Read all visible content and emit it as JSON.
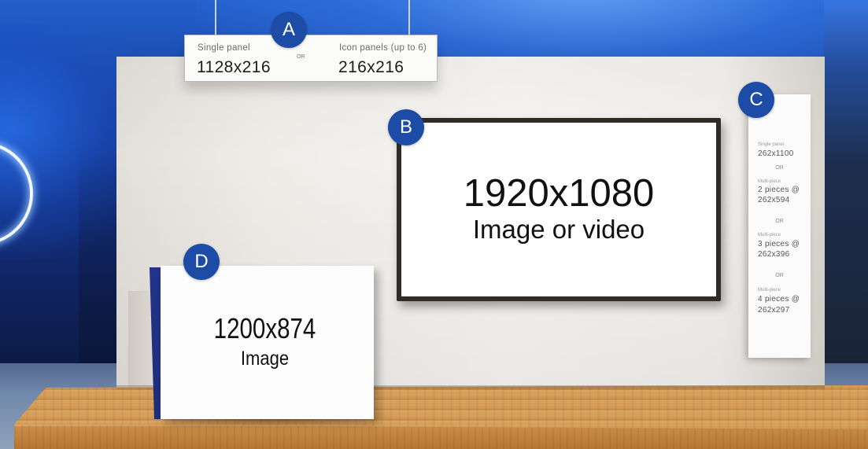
{
  "panels": {
    "a": {
      "badge": "A",
      "single_label": "Single panel",
      "single_size": "1128x216",
      "or_label": "OR",
      "icon_label": "Icon panels (up to 6)",
      "icon_size": "216x216"
    },
    "b": {
      "badge": "B",
      "size": "1920x1080",
      "caption": "Image or video"
    },
    "c": {
      "badge": "C",
      "or_label": "OR",
      "options": [
        {
          "label": "Single panel",
          "size": "262x1100"
        },
        {
          "label": "Multi-piece",
          "pieces": "2 pieces @",
          "size": "262x594"
        },
        {
          "label": "Multi-piece",
          "pieces": "3 pieces @",
          "size": "262x396"
        },
        {
          "label": "Multi-piece",
          "pieces": "4 pieces @",
          "size": "262x297"
        }
      ]
    },
    "d": {
      "badge": "D",
      "size": "1200x874",
      "caption": "Image"
    }
  },
  "colors": {
    "badge": "#1d4ca6",
    "badge_text": "#ffffff",
    "panel_text": "#111111",
    "screen_frame": "#2f2b27",
    "panel_d_side": "#1f2d7a",
    "stage_wood": "#d39a55"
  }
}
